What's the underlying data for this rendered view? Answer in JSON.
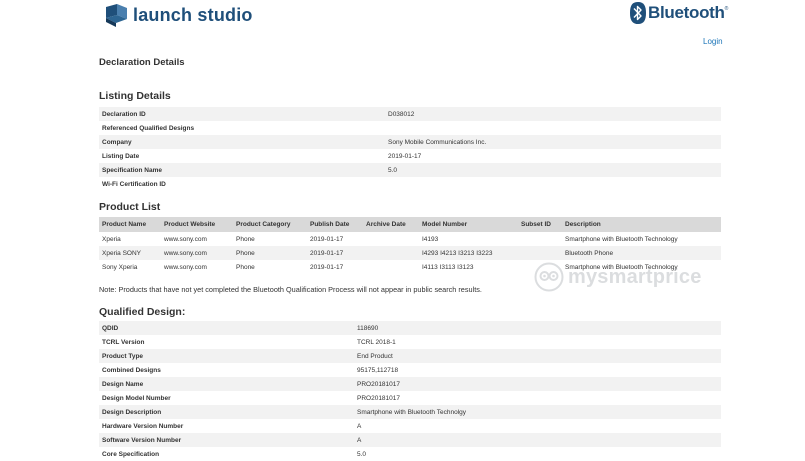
{
  "header": {
    "app_name": "launch studio",
    "bluetooth_wordmark": "Bluetooth",
    "bluetooth_trademark": "®",
    "login_label": "Login"
  },
  "declaration_details": {
    "title": "Declaration Details"
  },
  "listing_details": {
    "title": "Listing Details",
    "rows": [
      {
        "label": "Declaration ID",
        "value": "D038012"
      },
      {
        "label": "Referenced Qualified Designs",
        "value": ""
      },
      {
        "label": "Company",
        "value": "Sony Mobile Communications Inc."
      },
      {
        "label": "Listing Date",
        "value": "2019-01-17"
      },
      {
        "label": "Specification Name",
        "value": "5.0"
      },
      {
        "label": "Wi-Fi Certification ID",
        "value": ""
      }
    ]
  },
  "product_list": {
    "title": "Product List",
    "columns": [
      "Product Name",
      "Product Website",
      "Product Category",
      "Publish Date",
      "Archive Date",
      "Model Number",
      "Subset ID",
      "Description"
    ],
    "rows": [
      [
        "Xperia",
        "www.sony.com",
        "Phone",
        "2019-01-17",
        "",
        "I4193",
        "",
        "Smartphone with Bluetooth Technology"
      ],
      [
        "Xperia SONY",
        "www.sony.com",
        "Phone",
        "2019-01-17",
        "",
        "I4293 I4213 I3213 I3223",
        "",
        "Bluetooth Phone"
      ],
      [
        "Sony Xperia",
        "www.sony.com",
        "Phone",
        "2019-01-17",
        "",
        "I4113 I3113 I3123",
        "",
        "Smartphone with Bluetooth Technology"
      ]
    ],
    "note": "Note: Products that have not yet completed the Bluetooth Qualification Process will not appear in public search results."
  },
  "qualified_design": {
    "title": "Qualified Design:",
    "rows": [
      {
        "label": "QDID",
        "value": "118690"
      },
      {
        "label": "TCRL Version",
        "value": "TCRL 2018-1"
      },
      {
        "label": "Product Type",
        "value": "End Product"
      },
      {
        "label": "Combined Designs",
        "value": "95175,112718"
      },
      {
        "label": "Design Name",
        "value": "PRO20181017"
      },
      {
        "label": "Design Model Number",
        "value": "PRO20181017"
      },
      {
        "label": "Design Description",
        "value": "Smartphone with Bluetooth Technolgy"
      },
      {
        "label": "Hardware Version Number",
        "value": "A"
      },
      {
        "label": "Software Version Number",
        "value": "A"
      },
      {
        "label": "Core Specification",
        "value": "5.0"
      }
    ]
  },
  "watermark": {
    "text": "mysmartprice"
  },
  "colors": {
    "brand_navy": "#1f4f7a",
    "link_blue": "#1a74b8",
    "header_gray": "#d9d9d9",
    "row_alt": "#f2f2f2"
  }
}
